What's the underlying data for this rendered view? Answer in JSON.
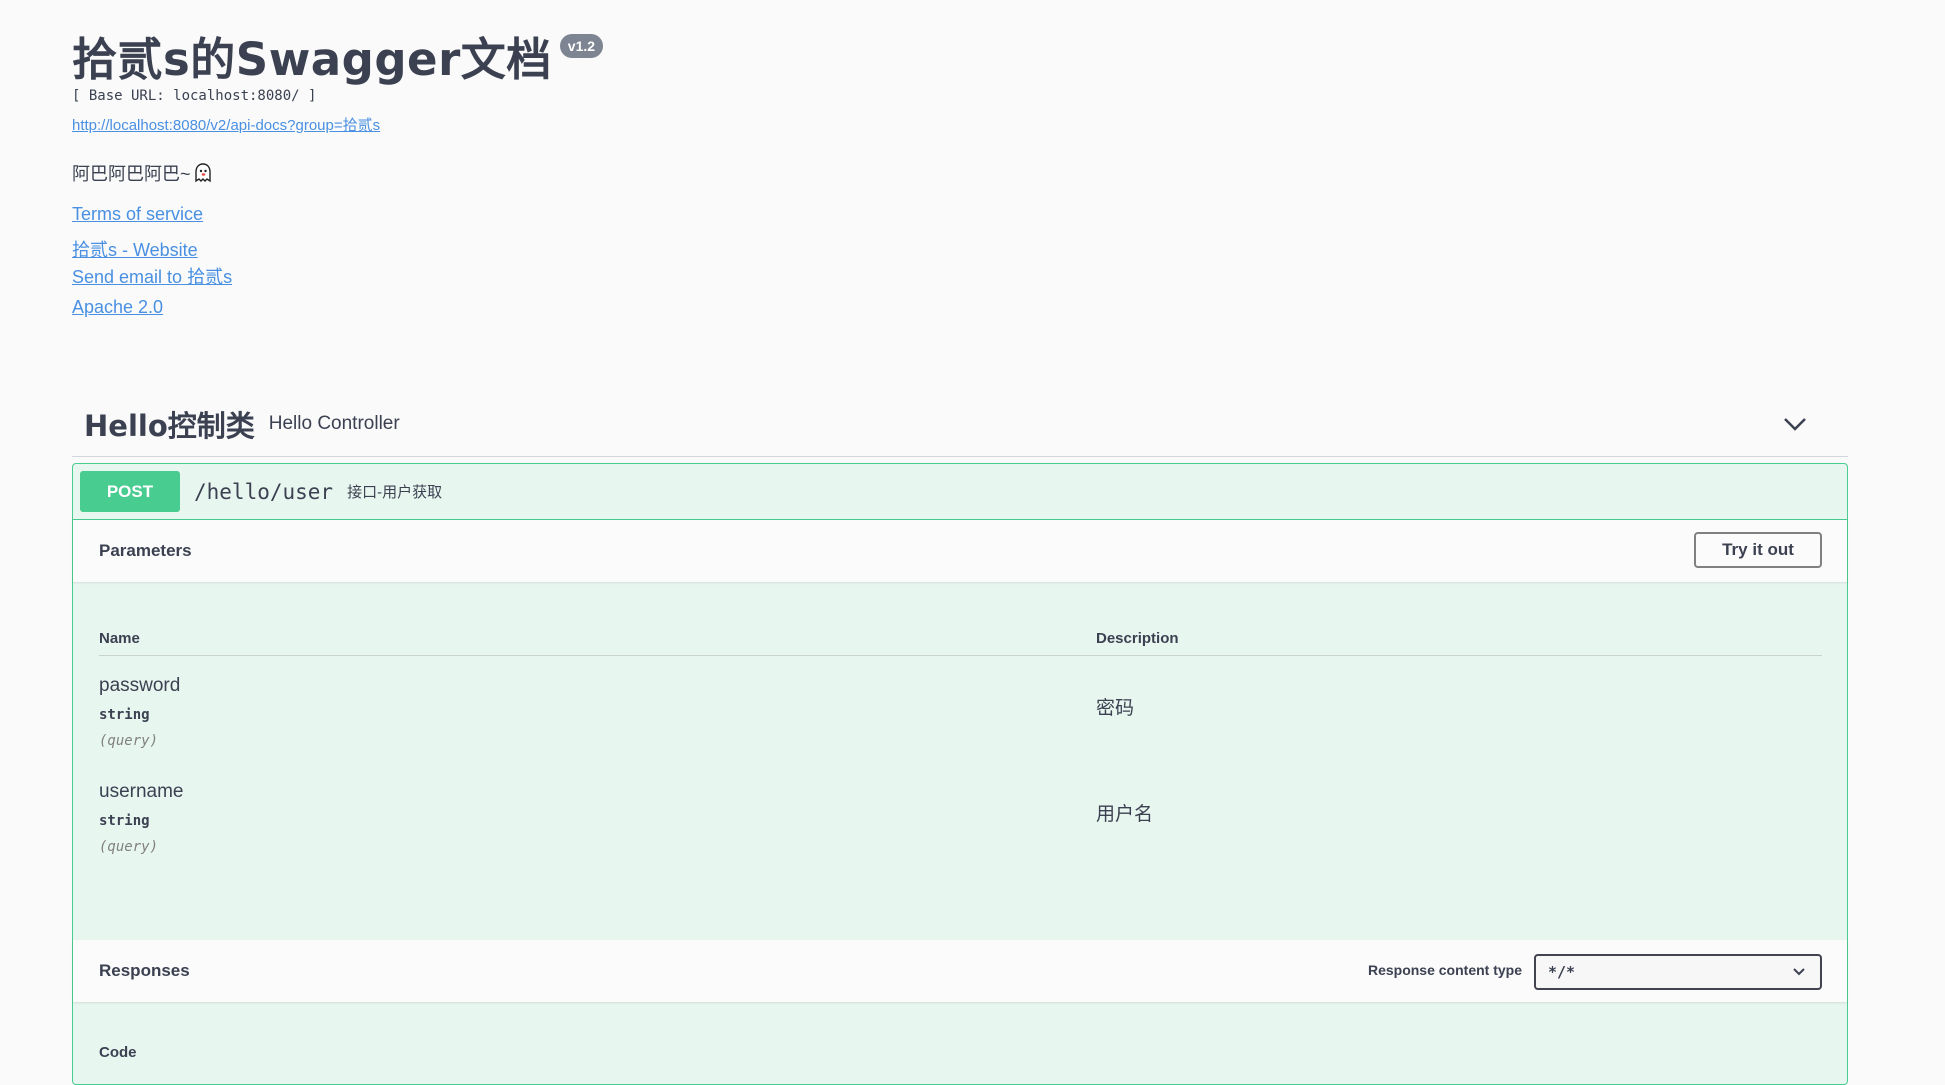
{
  "info": {
    "title": "拾贰s的Swagger文档",
    "version": "v1.2",
    "base_url": "[ Base URL: localhost:8080/ ]",
    "api_docs_link": "http://localhost:8080/v2/api-docs?group=拾贰s",
    "description": "阿巴阿巴阿巴~",
    "links": {
      "terms": "Terms of service",
      "website": "拾贰s - Website",
      "email": "Send email to 拾贰s",
      "license": "Apache 2.0"
    }
  },
  "tag": {
    "name": "Hello控制类",
    "description": "Hello Controller"
  },
  "operation": {
    "method": "POST",
    "path": "/hello/user",
    "summary": "接口-用户获取",
    "parameters_title": "Parameters",
    "try_it_out": "Try it out",
    "table_headers": {
      "name": "Name",
      "description": "Description"
    },
    "params": [
      {
        "name": "password",
        "type": "string",
        "in": "(query)",
        "description": "密码"
      },
      {
        "name": "username",
        "type": "string",
        "in": "(query)",
        "description": "用户名"
      }
    ],
    "responses_title": "Responses",
    "response_content_type_label": "Response content type",
    "response_content_type": "*/*",
    "code_header": "Code"
  },
  "colors": {
    "post": "#49cc90",
    "post_bg": "#e8f6f0",
    "link": "#4990e2",
    "text": "#3b4151"
  }
}
